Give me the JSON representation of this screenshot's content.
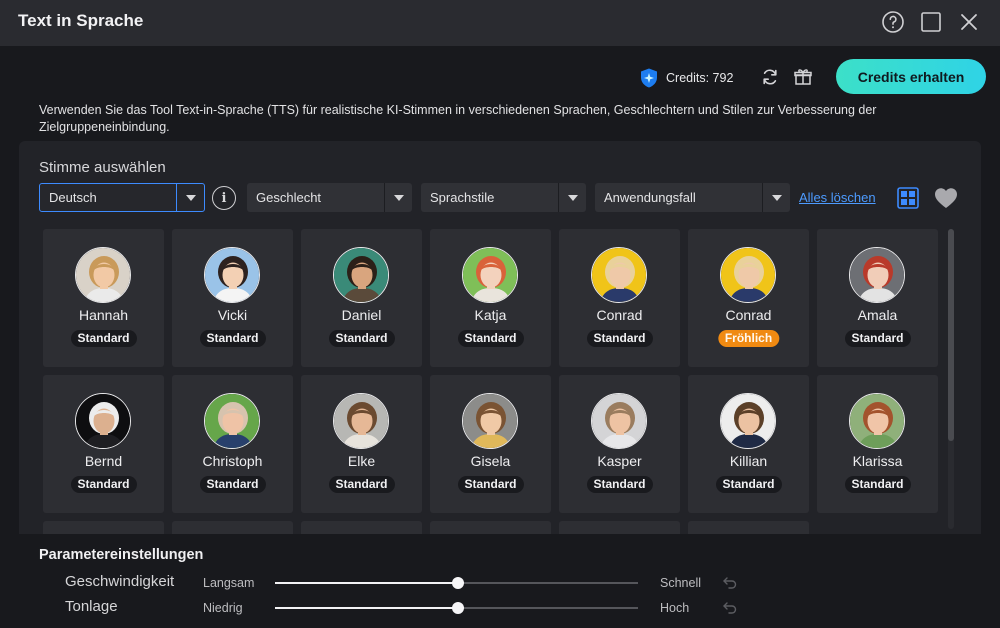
{
  "window": {
    "title": "Text in Sprache"
  },
  "header": {
    "credits_text": "Credits: 792",
    "cta_label": "Credits erhalten"
  },
  "description": "Verwenden Sie das Tool Text-in-Sprache (TTS) für realistische KI-Stimmen in verschiedenen Sprachen, Geschlechtern und Stilen zur Verbesserung der Zielgruppeneinbindung.",
  "voice_section": {
    "title": "Stimme auswählen",
    "filters": {
      "language": "Deutsch",
      "gender": "Geschlecht",
      "style": "Sprachstile",
      "usecase": "Anwendungsfall"
    },
    "clear_all": "Alles löschen",
    "voices": [
      {
        "name": "Hannah",
        "style": "Standard",
        "skin": "#f2c9a5",
        "hair": "#c99a5a",
        "bg": "#d9d2c8",
        "shirt": "#eaeaea"
      },
      {
        "name": "Vicki",
        "style": "Standard",
        "skin": "#f3d0b4",
        "hair": "#2d2220",
        "bg": "#9ac3e8",
        "shirt": "#f4f4f4"
      },
      {
        "name": "Daniel",
        "style": "Standard",
        "skin": "#d9a57e",
        "hair": "#2b2018",
        "bg": "#3a8a78",
        "shirt": "#5a4a3a"
      },
      {
        "name": "Katja",
        "style": "Standard",
        "skin": "#f3d2bd",
        "hair": "#d9623a",
        "bg": "#7fbf58",
        "shirt": "#e9e4dc"
      },
      {
        "name": "Conrad",
        "style": "Standard",
        "skin": "#efc9a8",
        "hair": "#e9d19a",
        "bg": "#f0c419",
        "shirt": "#2a3a6a"
      },
      {
        "name": "Conrad",
        "style": "Fröhlich",
        "skin": "#efc9a8",
        "hair": "#e9d19a",
        "bg": "#f0c419",
        "shirt": "#2a3a6a"
      },
      {
        "name": "Amala",
        "style": "Standard",
        "skin": "#f1cdb8",
        "hair": "#b93a2a",
        "bg": "#6d6f74",
        "shirt": "#e3e3e3"
      },
      {
        "name": "Bernd",
        "style": "Standard",
        "skin": "#dcb08f",
        "hair": "#ececec",
        "bg": "#0e0e10",
        "shirt": "#1e1e22"
      },
      {
        "name": "Christoph",
        "style": "Standard",
        "skin": "#efc3a6",
        "hair": "#d7c3ae",
        "bg": "#66a64a",
        "shirt": "#28406c"
      },
      {
        "name": "Elke",
        "style": "Standard",
        "skin": "#e6b896",
        "hair": "#6b4a30",
        "bg": "#b7b7b4",
        "shirt": "#e7e3dc"
      },
      {
        "name": "Gisela",
        "style": "Standard",
        "skin": "#f0c9a6",
        "hair": "#7a5333",
        "bg": "#8c8c8a",
        "shirt": "#e0b85a"
      },
      {
        "name": "Kasper",
        "style": "Standard",
        "skin": "#eec3a3",
        "hair": "#9a7c5e",
        "bg": "#d4d4d6",
        "shirt": "#e7e7e9"
      },
      {
        "name": "Killian",
        "style": "Standard",
        "skin": "#ecc2a2",
        "hair": "#5b3f28",
        "bg": "#ededed",
        "shirt": "#1f2a45"
      },
      {
        "name": "Klarissa",
        "style": "Standard",
        "skin": "#f0c5a8",
        "hair": "#a3532d",
        "bg": "#8fb07a",
        "shirt": "#6e9e5a"
      }
    ]
  },
  "params": {
    "title": "Parametereinstellungen",
    "speed": {
      "label": "Geschwindigkeit",
      "min": "Langsam",
      "max": "Schnell",
      "value": 0.5
    },
    "pitch": {
      "label": "Tonlage",
      "min": "Niedrig",
      "max": "Hoch",
      "value": 0.5
    }
  }
}
